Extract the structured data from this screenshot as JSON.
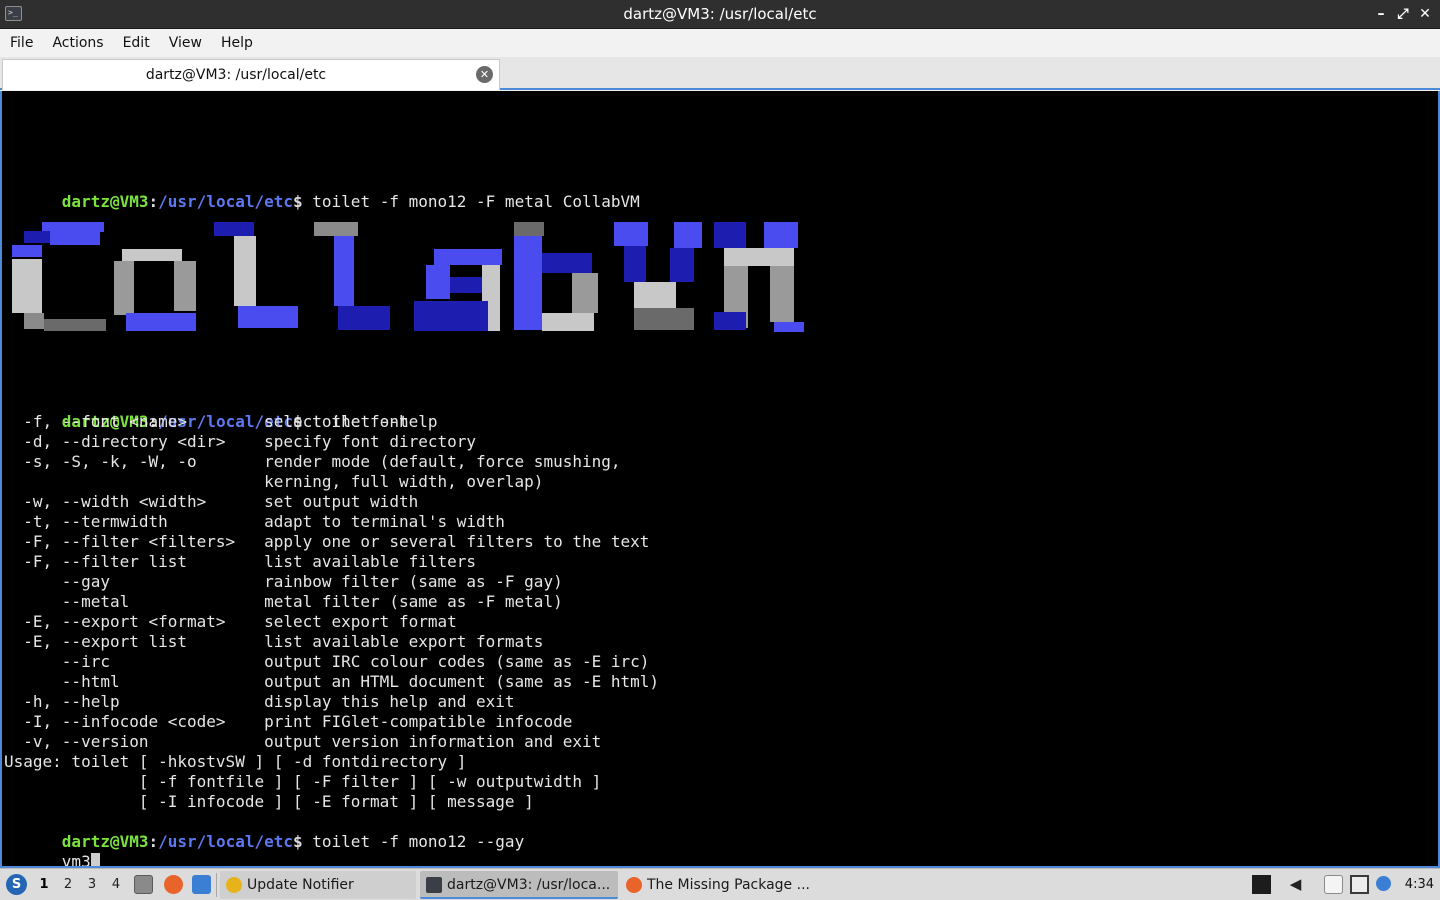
{
  "window": {
    "title": "dartz@VM3: /usr/local/etc",
    "minimize_glyph": "–",
    "maximize_glyph": "⤢",
    "close_glyph": "✕"
  },
  "menu": {
    "items": [
      {
        "label": "File"
      },
      {
        "label": "Actions"
      },
      {
        "label": "Edit"
      },
      {
        "label": "View"
      },
      {
        "label": "Help"
      }
    ]
  },
  "tab": {
    "label": "dartz@VM3: /usr/local/etc",
    "close_glyph": "✕"
  },
  "terminal": {
    "prompt": {
      "user": "dartz@VM3",
      "sep": ":",
      "path": "/usr/local/etc",
      "symbol": "$"
    },
    "command1": " toilet -f mono12 -F metal CollabVM",
    "banner_text": "CollabVM",
    "command2": " toilet --help",
    "help_lines": [
      "  -f, --font <name>        select the font",
      "  -d, --directory <dir>    specify font directory",
      "  -s, -S, -k, -W, -o       render mode (default, force smushing,",
      "                           kerning, full width, overlap)",
      "  -w, --width <width>      set output width",
      "  -t, --termwidth          adapt to terminal's width",
      "  -F, --filter <filters>   apply one or several filters to the text",
      "  -F, --filter list        list available filters",
      "      --gay                rainbow filter (same as -F gay)",
      "      --metal              metal filter (same as -F metal)",
      "  -E, --export <format>    select export format",
      "  -E, --export list        list available export formats",
      "      --irc                output IRC colour codes (same as -E irc)",
      "      --html               output an HTML document (same as -E html)",
      "  -h, --help               display this help and exit",
      "  -I, --infocode <code>    print FIGlet-compatible infocode",
      "  -v, --version            output version information and exit",
      "Usage: toilet [ -hkostvSW ] [ -d fontdirectory ]",
      "              [ -f fontfile ] [ -F filter ] [ -w outputwidth ]",
      "              [ -I infocode ] [ -E format ] [ message ]"
    ],
    "command3": " toilet -f mono12 --gay",
    "input_line": "vm3"
  },
  "taskbar": {
    "start_icon": "lxqt-start-icon",
    "workspaces": [
      "1",
      "2",
      "3",
      "4"
    ],
    "active_workspace": "1",
    "launchers": [
      {
        "name": "file-manager-icon",
        "color": "#7a7a7a"
      },
      {
        "name": "firefox-icon",
        "color": "#e8642a"
      },
      {
        "name": "desktop-icon",
        "color": "#3b7fd4"
      }
    ],
    "tasks": [
      {
        "label": "Update Notifier",
        "icon": "update-notifier-icon",
        "icon_color": "#e8b21c"
      },
      {
        "label": "dartz@VM3: /usr/loca...",
        "icon": "terminal-icon",
        "icon_color": "#3a3f46"
      },
      {
        "label": "The Missing Package ...",
        "icon": "firefox-icon",
        "icon_color": "#e8642a"
      }
    ],
    "tray": [
      {
        "name": "keyboard-layout-icon"
      },
      {
        "name": "volume-icon"
      },
      {
        "name": "clipboard-icon"
      },
      {
        "name": "network-icon"
      },
      {
        "name": "notification-icon"
      }
    ],
    "clock": "4:34"
  },
  "colors": {
    "accent": "#4d8ad8",
    "prompt_user": "#7be23e",
    "prompt_path": "#5d78f0",
    "banner_blue_bright": "#4a4cf0",
    "banner_blue_dark": "#1d1db0",
    "banner_gray_light": "#c8c8c8",
    "banner_gray_dark": "#6a6a6a"
  }
}
